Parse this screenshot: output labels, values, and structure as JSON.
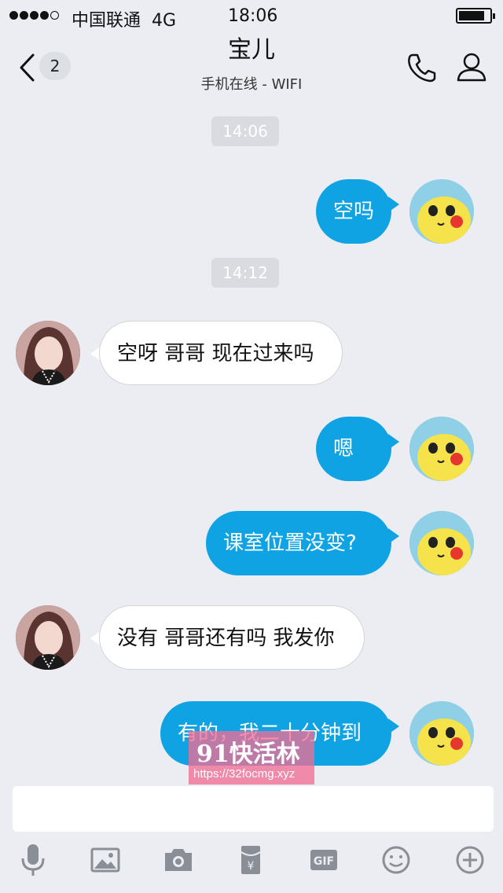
{
  "status_bar": {
    "carrier": "中国联通",
    "network": "4G",
    "time": "18:06",
    "battery_level": 0.85
  },
  "header": {
    "back_badge": "2",
    "title": "宝儿",
    "subtitle": "手机在线 - WIFI"
  },
  "messages": {
    "time1": "14:06",
    "time2": "14:12",
    "m1": "空吗",
    "m2": "空呀 哥哥 现在过来吗",
    "m3": "嗯",
    "m4": "课室位置没变?",
    "m5": "没有 哥哥还有吗 我发你",
    "m6": "有的，我二十分钟到"
  },
  "watermark": {
    "text": "91快活林",
    "url": "https://32focmg.xyz"
  },
  "input": {
    "value": "",
    "placeholder": ""
  },
  "toolbar": {
    "gif_label": "GIF",
    "yen_label": "¥",
    "icons": [
      "microphone-icon",
      "image-icon",
      "camera-icon",
      "red-packet-icon",
      "gif-icon",
      "emoji-icon",
      "plus-icon"
    ]
  },
  "colors": {
    "background": "#ebedf2",
    "outgoing_bubble": "#0fa3e4",
    "incoming_bubble": "#ffffff",
    "time_chip": "#d9dbe0",
    "icon_gray": "#8a8e96"
  }
}
